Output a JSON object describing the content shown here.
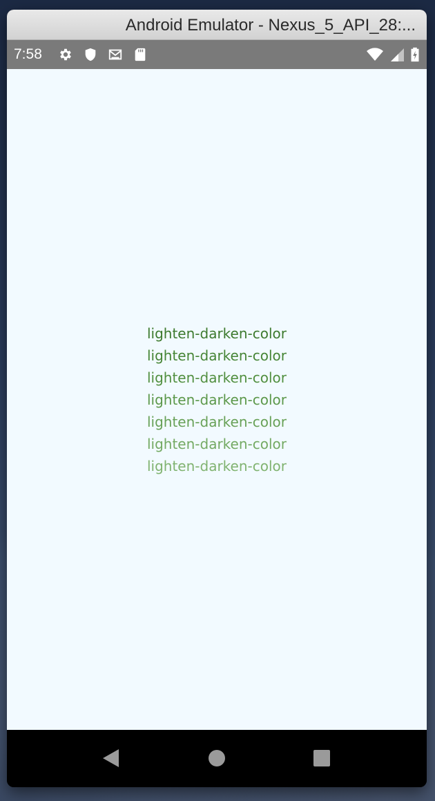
{
  "window": {
    "title": "Android Emulator - Nexus_5_API_28:..."
  },
  "statusbar": {
    "time": "7:58",
    "left_icons": [
      "gear-icon",
      "shield-icon",
      "gmail-icon",
      "sd-card-icon"
    ],
    "right_icons": [
      "wifi-icon",
      "signal-icon",
      "battery-icon"
    ]
  },
  "screen": {
    "background": "#f2faff",
    "labels": [
      {
        "text": "lighten-darken-color",
        "color": "#3d7a2e"
      },
      {
        "text": "lighten-darken-color",
        "color": "#468535"
      },
      {
        "text": "lighten-darken-color",
        "color": "#518f3f"
      },
      {
        "text": "lighten-darken-color",
        "color": "#5c984a"
      },
      {
        "text": "lighten-darken-color",
        "color": "#68a157"
      },
      {
        "text": "lighten-darken-color",
        "color": "#74aa63"
      },
      {
        "text": "lighten-darken-color",
        "color": "#80b370"
      }
    ]
  },
  "navbar": {
    "buttons": [
      "back-icon",
      "home-icon",
      "recents-icon"
    ]
  }
}
